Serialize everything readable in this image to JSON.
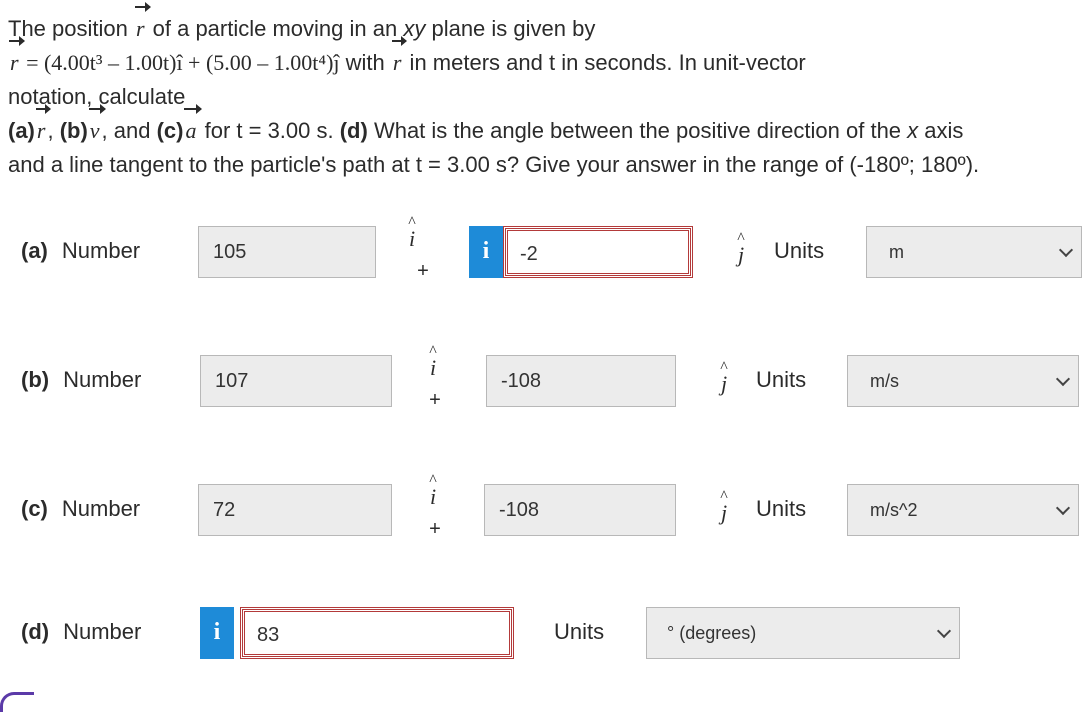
{
  "problem": {
    "l1_pre": "The position ",
    "r_sym": "r",
    "l1_post": " of a particle moving in an ",
    "l1_xy": "xy",
    "l1_end": " plane is given by",
    "l2_eq": " = (4.00t³ – 1.00t)î + (5.00 – 1.00t⁴)ĵ",
    "l2_with": " with ",
    "l2_post": " in meters and ",
    "l2_t": "t",
    "l2_end": " in seconds. In unit-vector",
    "l3": "notation, calculate",
    "l4_a": "(a)",
    "l4_b": "(b)",
    "l4_v": "v",
    "l4_and": ", and ",
    "l4_c": "(c)",
    "l4_a_sym": "a",
    "l4_for": " for t = 3.00 s. ",
    "l4_d": "(d)",
    "l4_rest": " What is the angle between the positive direction of the ",
    "l4_x": "x",
    "l4_axis": " axis",
    "l5": "and a line tangent to the particle's path at t = 3.00 s? Give your answer in the range of (-180º; 180º)."
  },
  "parts": [
    {
      "tag": "(a)",
      "label": "Number",
      "i_value": "105",
      "j_value": "-2",
      "units_label": "Units",
      "unit": "m"
    },
    {
      "tag": "(b)",
      "label": "Number",
      "i_value": "107",
      "j_value": "-108",
      "units_label": "Units",
      "unit": "m/s"
    },
    {
      "tag": "(c)",
      "label": "Number",
      "i_value": "72",
      "j_value": "-108",
      "units_label": "Units",
      "unit": "m/s^2"
    },
    {
      "tag": "(d)",
      "label": "Number",
      "value": "83",
      "units_label": "Units",
      "unit": "° (degrees)"
    }
  ],
  "symbols": {
    "i_hat": "i",
    "j_hat": "j",
    "hat": "^",
    "plus": "+",
    "info": "i"
  },
  "colors": {
    "info_badge": "#1e8bd8",
    "error_border": "#b33a3a",
    "field_bg": "#ececec"
  }
}
